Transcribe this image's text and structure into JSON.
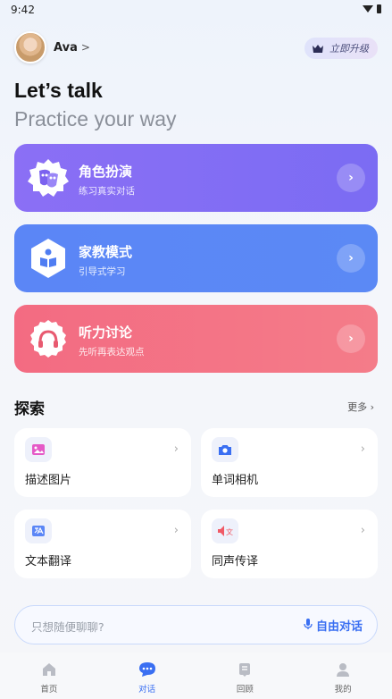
{
  "status_bar": {
    "time": "9:42"
  },
  "profile": {
    "name": "Ava",
    "chevron": ">"
  },
  "upgrade": {
    "label": "立即升级"
  },
  "hero": {
    "title": "Let’s talk",
    "subtitle": "Practice your way"
  },
  "modes": [
    {
      "title": "角色扮演",
      "subtitle": "练习真实对话",
      "icon": "theater-masks-icon",
      "color": "#8b6ff5"
    },
    {
      "title": "家教模式",
      "subtitle": "引导式学习",
      "icon": "book-reader-icon",
      "color": "#5b86f6"
    },
    {
      "title": "听力讨论",
      "subtitle": "先听再表达观点",
      "icon": "headphones-icon",
      "color": "#f36b82"
    }
  ],
  "explore": {
    "title": "探索",
    "more": "更多 ›",
    "items": [
      {
        "label": "描述图片",
        "icon": "image-icon",
        "color": "#e55ac7"
      },
      {
        "label": "单词相机",
        "icon": "camera-icon",
        "color": "#3a6ff2"
      },
      {
        "label": "文本翻译",
        "icon": "translate-icon",
        "color": "#5b86f6"
      },
      {
        "label": "同声传译",
        "icon": "speaker-translate-icon",
        "color": "#f05a66"
      }
    ]
  },
  "chat": {
    "placeholder": "只想随便聊聊?",
    "action_label": "自由对话"
  },
  "tabs": [
    {
      "label": "首页",
      "icon": "home-icon",
      "active": false
    },
    {
      "label": "对话",
      "icon": "chat-icon",
      "active": true
    },
    {
      "label": "回顾",
      "icon": "review-icon",
      "active": false
    },
    {
      "label": "我的",
      "icon": "profile-icon",
      "active": false
    }
  ],
  "colors": {
    "accent": "#3a6ff2"
  }
}
